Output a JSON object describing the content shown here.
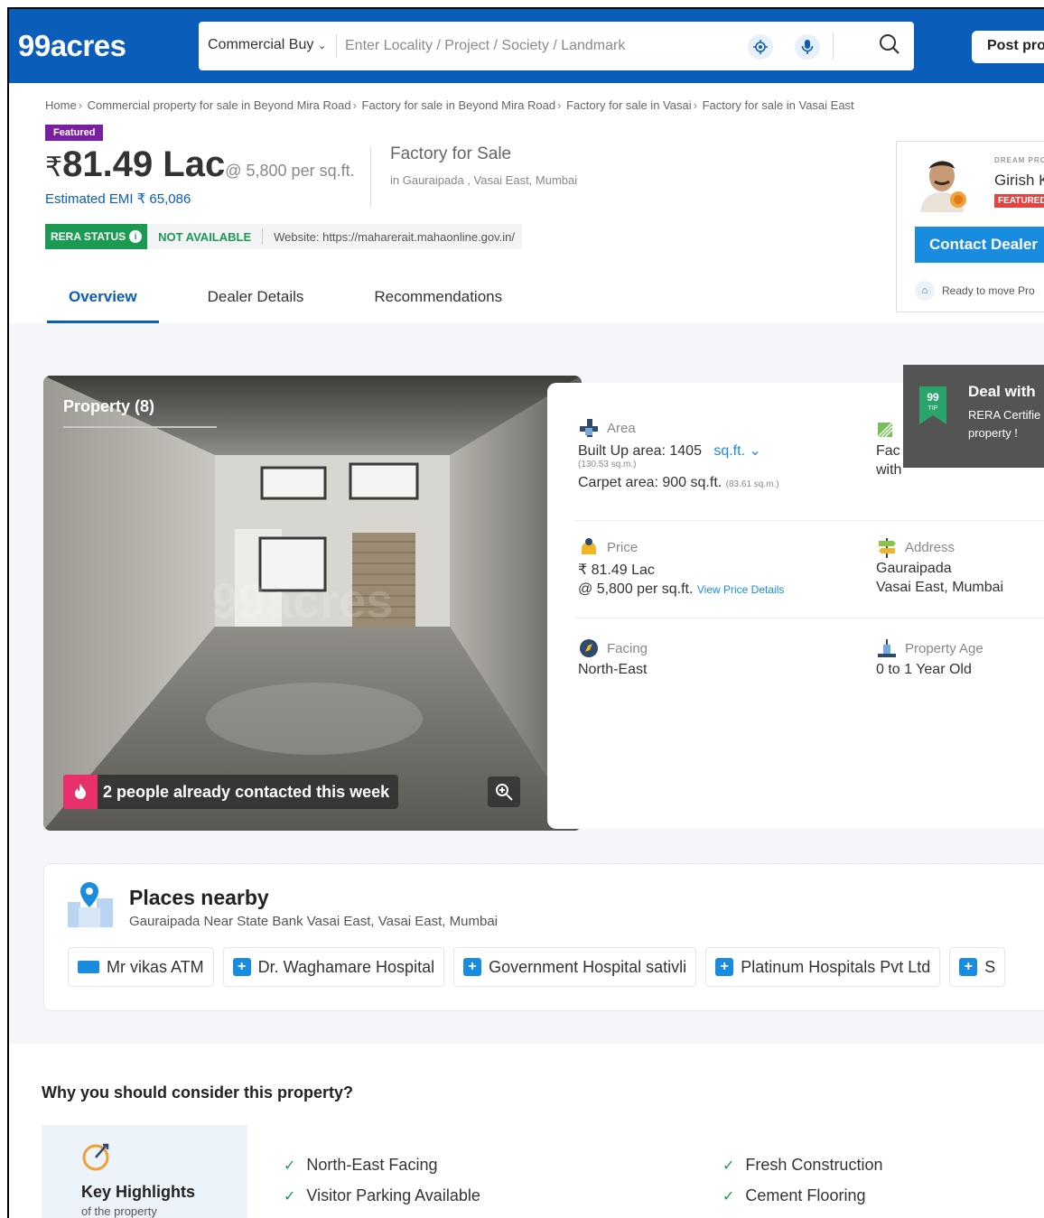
{
  "header": {
    "logo": "99acres",
    "category": "Commercial Buy",
    "search_placeholder": "Enter Locality / Project / Society / Landmark",
    "post_label": "Post prop"
  },
  "breadcrumb": [
    "Home",
    "Commercial property for sale in Beyond Mira Road",
    "Factory for sale in Beyond Mira Road",
    "Factory for sale in Vasai",
    "Factory for sale in Vasai East"
  ],
  "listing": {
    "featured_label": "Featured",
    "rupee": "₹",
    "price": "81.49 Lac",
    "per_sqft": "@ 5,800 per sq.ft.",
    "emi": "Estimated EMI ₹ 65,086",
    "type": "Factory for Sale",
    "location": "in Gauraipada , Vasai East, Mumbai",
    "rera_label": "RERA STATUS",
    "rera_status": "NOT AVAILABLE",
    "rera_website": "Website: https://maharerait.mahaonline.gov.in/"
  },
  "tabs": [
    "Overview",
    "Dealer Details",
    "Recommendations"
  ],
  "dealer": {
    "dream_label": "DREAM PRO",
    "name": "Girish K",
    "featured": "FEATURED",
    "contact_label": "Contact Dealer",
    "ready_text": "Ready to move Pro"
  },
  "photo": {
    "title": "Property (8)",
    "contacted_text": "2 people already contacted this week"
  },
  "details": {
    "area_label": "Area",
    "built_up": "Built Up area: 1405",
    "built_up_unit": "sq.ft.",
    "built_up_sqm": "(130.53 sq.m.)",
    "carpet": "Carpet area: 900 sq.ft.",
    "carpet_sqm": "(83.61 sq.m.)",
    "facility_label": "Fac",
    "facility_value": "with",
    "price_label": "Price",
    "price_value": "₹ 81.49 Lac",
    "price_per": "@ 5,800 per sq.ft.",
    "price_link": "View Price Details",
    "address_label": "Address",
    "address_line1": "Gauraipada",
    "address_line2": "Vasai East, Mumbai",
    "facing_label": "Facing",
    "facing_value": "North-East",
    "age_label": "Property Age",
    "age_value": "0 to 1 Year Old"
  },
  "tip": {
    "badge": "99 TIP",
    "title": "Deal with",
    "text": "RERA Certifie property !"
  },
  "places": {
    "title": "Places nearby",
    "address": "Gauraipada Near State Bank Vasai East, Vasai East, Mumbai",
    "chips": [
      "Mr vikas ATM",
      "Dr. Waghamare Hospital",
      "Government Hospital sativli",
      "Platinum Hospitals Pvt Ltd",
      "S"
    ]
  },
  "why": {
    "title": "Why you should consider this property?",
    "kh_title": "Key Highlights",
    "kh_sub": "of the property",
    "highlights": [
      "North-East Facing",
      "Visitor Parking Available",
      "Fresh Construction",
      "Cement Flooring"
    ]
  },
  "colors": {
    "brand_blue": "#0a5db8",
    "link_blue": "#1a8ce0",
    "featured_purple": "#7a1fa2",
    "rera_green": "#1a9a52"
  }
}
